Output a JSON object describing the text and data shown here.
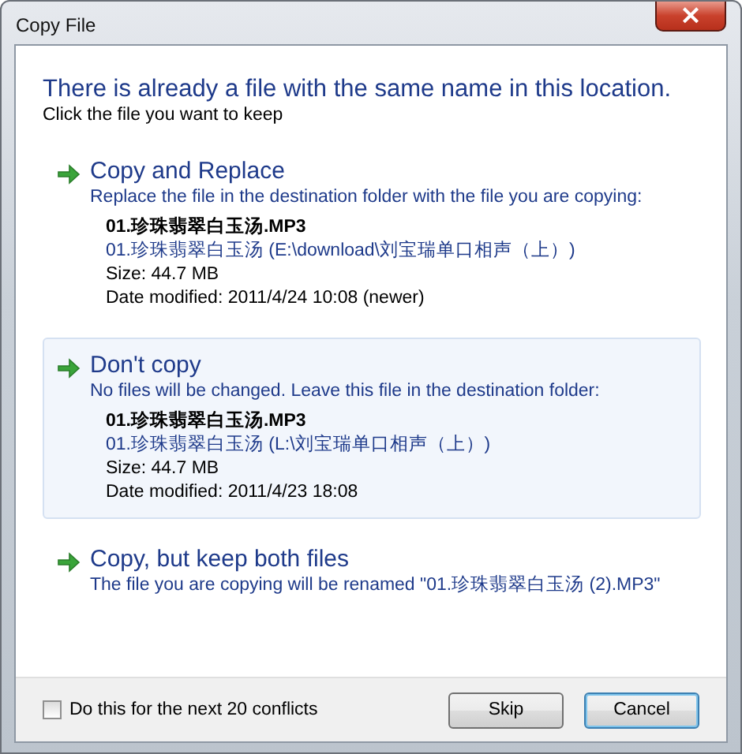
{
  "window": {
    "title": "Copy File",
    "close": "×"
  },
  "heading": "There is already a file with the same name in this location.",
  "instruction": "Click the file you want to keep",
  "options": [
    {
      "title": "Copy and Replace",
      "description": "Replace the file in the destination folder with the file you are copying:",
      "highlighted": false,
      "file": {
        "name": "01.珍珠翡翠白玉汤.MP3",
        "path": "01.珍珠翡翠白玉汤 (E:\\download\\刘宝瑞单口相声（上）)",
        "size": "Size: 44.7 MB",
        "date": "Date modified: 2011/4/24 10:08 (newer)"
      }
    },
    {
      "title": "Don't copy",
      "description": "No files will be changed. Leave this file in the destination folder:",
      "highlighted": true,
      "file": {
        "name": "01.珍珠翡翠白玉汤.MP3",
        "path": "01.珍珠翡翠白玉汤 (L:\\刘宝瑞单口相声（上）)",
        "size": "Size: 44.7 MB",
        "date": "Date modified: 2011/4/23 18:08"
      }
    },
    {
      "title": "Copy, but keep both files",
      "description": "The file you are copying will be renamed \"01.珍珠翡翠白玉汤 (2).MP3\"",
      "highlighted": false
    }
  ],
  "footer": {
    "checkbox": {
      "label": "Do this for the next 20 conflicts",
      "checked": false
    },
    "buttons": [
      {
        "label": "Skip",
        "default": false
      },
      {
        "label": "Cancel",
        "default": true
      }
    ]
  }
}
